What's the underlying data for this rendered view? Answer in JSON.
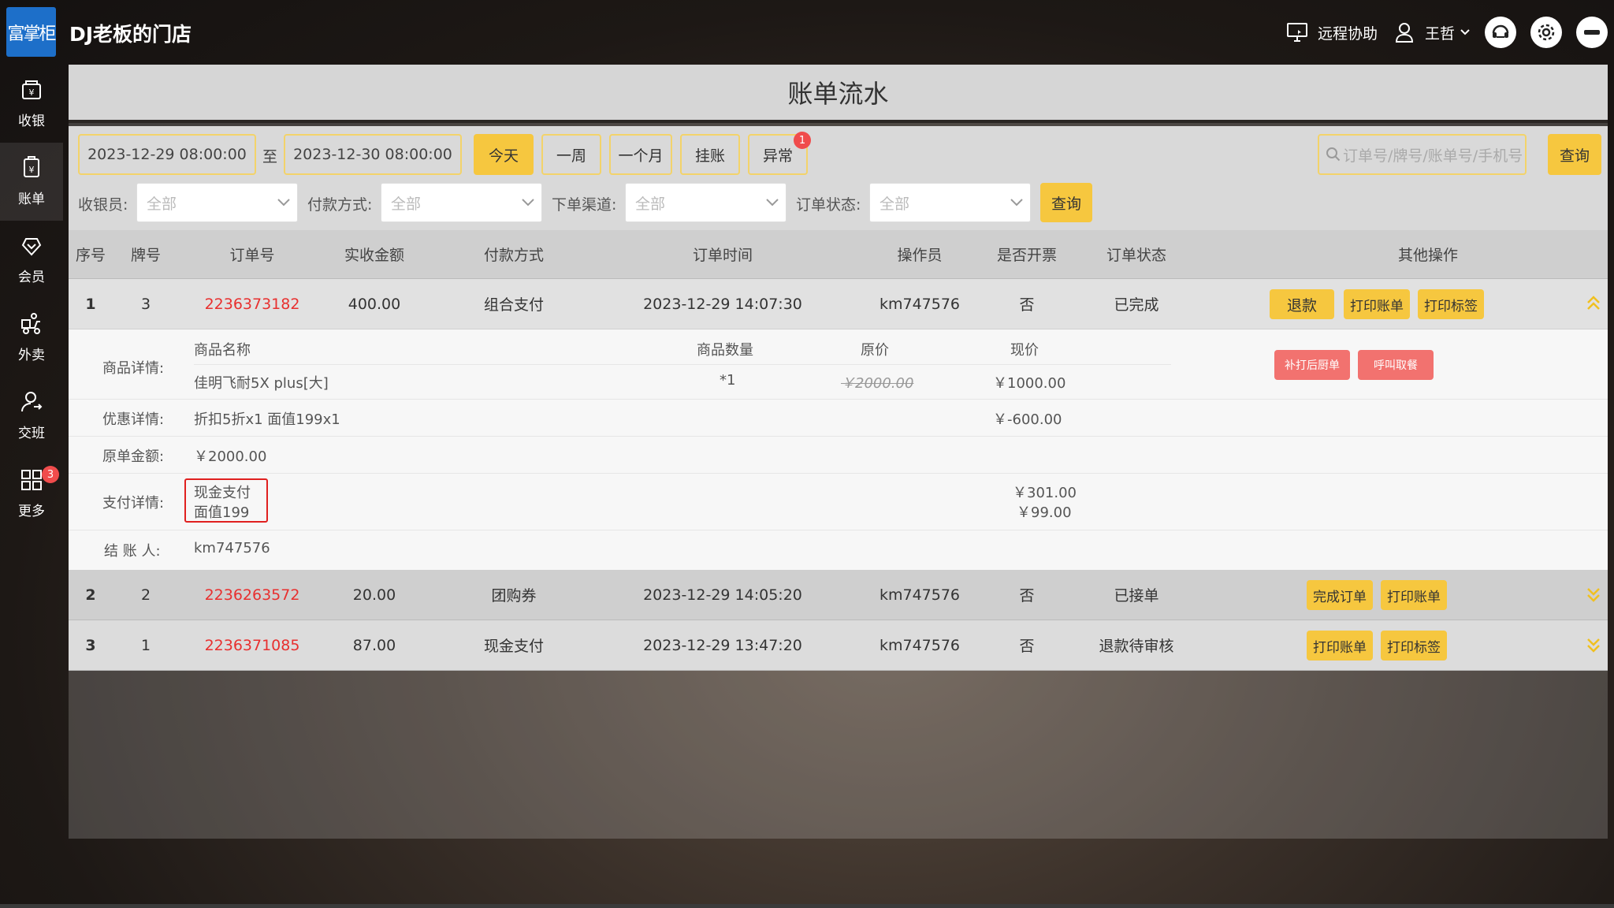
{
  "header": {
    "logo_text": "富掌柜",
    "store_name": "DJ老板的门店",
    "remote_help": "远程协助",
    "user_name": "王哲"
  },
  "sidebar": {
    "items": [
      {
        "label": "收银",
        "icon": "cashier-icon"
      },
      {
        "label": "账单",
        "icon": "bill-icon"
      },
      {
        "label": "会员",
        "icon": "member-icon"
      },
      {
        "label": "外卖",
        "icon": "delivery-icon"
      },
      {
        "label": "交班",
        "icon": "shift-icon"
      },
      {
        "label": "更多",
        "icon": "grid-icon",
        "badge": "3"
      }
    ]
  },
  "page": {
    "title": "账单流水"
  },
  "filters": {
    "start_date": "2023-12-29 08:00:00",
    "to_label": "至",
    "end_date": "2023-12-30 08:00:00",
    "quick": [
      "今天",
      "一周",
      "一个月",
      "挂账",
      "异常"
    ],
    "abnormal_badge": "1",
    "search_placeholder": "订单号/牌号/账单号/手机号",
    "search_button": "查询",
    "cashier_label": "收银员:",
    "cashier_value": "全部",
    "payment_label": "付款方式:",
    "payment_value": "全部",
    "channel_label": "下单渠道:",
    "channel_value": "全部",
    "status_label": "订单状态:",
    "status_value": "全部",
    "query_button": "查询"
  },
  "table": {
    "columns": [
      "序号",
      "牌号",
      "订单号",
      "实收金额",
      "付款方式",
      "订单时间",
      "操作员",
      "是否开票",
      "订单状态",
      "其他操作"
    ],
    "rows": [
      {
        "seq": "1",
        "plate": "3",
        "order_no": "2236373182",
        "amount": "400.00",
        "pay": "组合支付",
        "time": "2023-12-29 14:07:30",
        "operator": "km747576",
        "invoice": "否",
        "status": "已完成",
        "actions": [
          "退款",
          "打印账单",
          "打印标签"
        ]
      },
      {
        "seq": "2",
        "plate": "2",
        "order_no": "2236263572",
        "amount": "20.00",
        "pay": "团购券",
        "time": "2023-12-29 14:05:20",
        "operator": "km747576",
        "invoice": "否",
        "status": "已接单",
        "actions": [
          "完成订单",
          "打印账单"
        ]
      },
      {
        "seq": "3",
        "plate": "1",
        "order_no": "2236371085",
        "amount": "87.00",
        "pay": "现金支付",
        "time": "2023-12-29 13:47:20",
        "operator": "km747576",
        "invoice": "否",
        "status": "退款待审核",
        "actions": [
          "打印账单",
          "打印标签"
        ]
      }
    ]
  },
  "detail": {
    "goods_label": "商品详情:",
    "goods_headers": [
      "商品名称",
      "商品数量",
      "原价",
      "现价"
    ],
    "goods_item": {
      "name": "佳明飞耐5X plus[大]",
      "qty": "*1",
      "orig": "￥2000.00",
      "now": "￥1000.00"
    },
    "kitchen_reprint": "补打后厨单",
    "call_pickup": "呼叫取餐",
    "discount_label": "优惠详情:",
    "discount_desc": "折扣5折x1 面值199x1",
    "discount_amount": "￥-600.00",
    "original_label": "原单金额:",
    "original_amount": "￥2000.00",
    "payment_label": "支付详情:",
    "payment_methods": [
      "现金支付",
      "面值199"
    ],
    "payment_amounts": [
      "￥301.00",
      "￥99.00"
    ],
    "settler_label": "结 账 人:",
    "settler": "km747576"
  }
}
